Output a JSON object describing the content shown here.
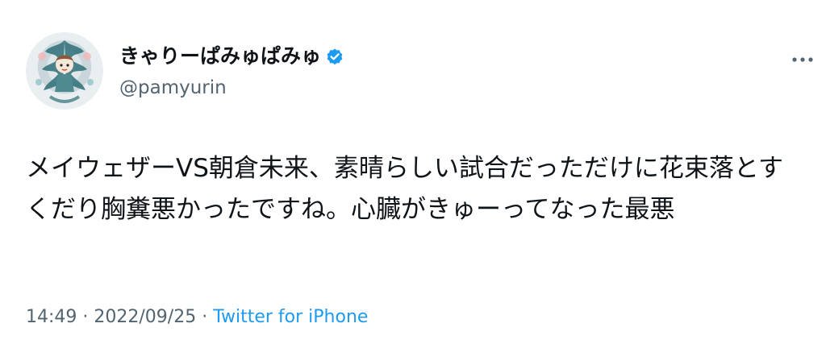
{
  "author": {
    "display_name": "きゃりーぱみゅぱみゅ",
    "handle": "@pamyurin",
    "verified": true
  },
  "tweet": {
    "text": "メイウェザーVS朝倉未来、素晴らしい試合だっただけに花束落とすくだり胸糞悪かったですね。心臓がきゅーってなった最悪"
  },
  "meta": {
    "time": "14:49",
    "separator1": " · ",
    "date": "2022/09/25",
    "separator2": " · ",
    "source": "Twitter for iPhone"
  },
  "icons": {
    "verified": "verified-badge-icon",
    "more": "more-options-icon"
  },
  "colors": {
    "verified": "#1d9bf0",
    "link": "#1d9bf0",
    "secondary_text": "#536471"
  }
}
